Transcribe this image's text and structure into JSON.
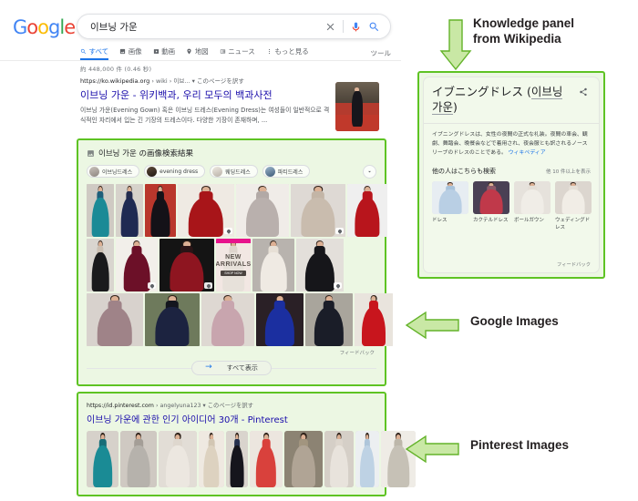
{
  "browser": {
    "logo_letters": [
      "G",
      "o",
      "o",
      "g",
      "l",
      "e"
    ],
    "search": {
      "query": "이브닝 가운",
      "placeholder": "검색",
      "clear_icon": "close-icon",
      "mic_icon": "microphone-icon",
      "search_icon": "search-icon"
    },
    "nav": {
      "tabs": [
        {
          "label": "すべて",
          "icon": "search-icon",
          "active": true
        },
        {
          "label": "画像",
          "icon": "image-icon",
          "active": false
        },
        {
          "label": "動画",
          "icon": "video-icon",
          "active": false
        },
        {
          "label": "地図",
          "icon": "map-pin-icon",
          "active": false
        },
        {
          "label": "ニュース",
          "icon": "news-icon",
          "active": false
        },
        {
          "label": "もっと見る",
          "icon": "more-vertical-icon",
          "active": false
        }
      ],
      "tools_label": "ツール"
    }
  },
  "results": {
    "stats": "約 448,000 件 (0.46 秒)",
    "organic": {
      "domain": "https://ko.wikipedia.org",
      "path": "› wiki › 이브...",
      "cache_label": "このページを訳す",
      "title": "이브닝 가운 - 위키백과, 우리 모두의 백과사전",
      "snippet": "이브닝 가운(Evening Gown) 혹은 이브닝 드레스(Evening Dress)는 여성들이 일반적으로 격식적인 자리에서 입는 긴 기장의 드레스이다. 다양한 기장이 존재하며, ..."
    }
  },
  "images_block": {
    "heading": "이브닝 가운 の画像検索結果",
    "heading_icon": "image-icon",
    "chips": [
      {
        "label": "이브닝드레스"
      },
      {
        "label": "evening dress"
      },
      {
        "label": "웨딩드레스"
      },
      {
        "label": "파티드레스"
      }
    ],
    "chips_more_icon": "chevron-down-icon",
    "feedback_label": "フィードバック",
    "show_all_label": "すべて表示",
    "show_all_icon": "arrow-right-icon",
    "grid": [
      [
        {
          "alt": "teal evening gown",
          "w": 30,
          "dress": "#1b8a96",
          "bg": "#cfcac3",
          "torso": "#1f5f7a"
        },
        {
          "alt": "navy evening gown",
          "w": 30,
          "dress": "#1f2a52",
          "bg": "#d6d2cb",
          "torso": "#232c4e"
        },
        {
          "alt": "black red carpet gown",
          "w": 34,
          "dress": "#141218",
          "bg": "#b9372c",
          "torso": "#141218"
        },
        {
          "alt": "two red gowns",
          "w": 62,
          "dress": "#a81519",
          "bg": "#efeae3",
          "torso": "#a81519",
          "badge": true
        },
        {
          "alt": "silver sequin gowns",
          "w": 58,
          "dress": "#b9b0ad",
          "bg": "#f0ece8",
          "torso": "#b2a9a6"
        },
        {
          "alt": "nude couture gown",
          "w": 60,
          "dress": "#c9bcae",
          "bg": "#ded9d4",
          "torso": "#c3b5a6",
          "badge": true
        },
        {
          "alt": "red off shoulder gown",
          "w": 44,
          "dress": "#b8151c",
          "bg": "#efefef",
          "torso": "#b8151c"
        }
      ],
      [
        {
          "alt": "black sheer gown",
          "w": 30,
          "dress": "#1a1a1c",
          "bg": "#d9d5cf",
          "torso": "#cbbfb2"
        },
        {
          "alt": "burgundy mermaid gown",
          "w": 46,
          "dress": "#6c1028",
          "bg": "#f2efea",
          "torso": "#6c1028",
          "badge": true
        },
        {
          "alt": "red beaded black gown",
          "w": 60,
          "dress": "#8e1520",
          "bg": "#141414",
          "torso": "#2a1416",
          "badge": true
        },
        {
          "alt": "white gown new arrivals",
          "w": 38,
          "dress": "#e7e1da",
          "bg": "#f2e7e3",
          "torso": "#ded5cd",
          "overlay_title": "NEW",
          "overlay_title2": "ARRIVALS",
          "overlay_cta": "SHOP NOW"
        },
        {
          "alt": "white lace gown",
          "w": 46,
          "dress": "#efeae3",
          "bg": "#b8b3ae",
          "torso": "#e7e0d6"
        },
        {
          "alt": "black strapless gown",
          "w": 52,
          "dress": "#16161a",
          "bg": "#e3dfda",
          "torso": "#16161a",
          "badge": true
        }
      ],
      [
        {
          "alt": "mauve vintage gown",
          "w": 62,
          "dress": "#9f8388",
          "bg": "#d8d2cd",
          "torso": "#9f8388"
        },
        {
          "alt": "couple formal wear",
          "w": 60,
          "dress": "#1c2340",
          "bg": "#6e7a5c",
          "torso": "#14161e"
        },
        {
          "alt": "pink tulle gown",
          "w": 58,
          "dress": "#c8a5ae",
          "bg": "#ded8d2",
          "torso": "#c8a5ae"
        },
        {
          "alt": "blue sequin gown",
          "w": 52,
          "dress": "#1b2fa0",
          "bg": "#2a2026",
          "torso": "#1b2fa0"
        },
        {
          "alt": "black feather gown",
          "w": 52,
          "dress": "#1a1d28",
          "bg": "#a9a59c",
          "torso": "#1a1d28"
        },
        {
          "alt": "red ballgown",
          "w": 42,
          "dress": "#c8151d",
          "bg": "#e9e4dd",
          "torso": "#c8151d"
        }
      ]
    ]
  },
  "pinterest_block": {
    "domain": "https://id.pinterest.com",
    "path": "› angelyuna123",
    "cache_label": "このページを訳す",
    "title": "이브닝 가운에 관한 인기 아이디어 30개 - Pinterest",
    "images": [
      {
        "alt": "teal gown",
        "w": 35,
        "dress": "#1a8b95",
        "bg": "#d6d1ca",
        "torso": "#186d78"
      },
      {
        "alt": "silver ballgown",
        "w": 40,
        "dress": "#b6b2ac",
        "bg": "#cfc9c2",
        "torso": "#a49e97"
      },
      {
        "alt": "white ballgown",
        "w": 42,
        "dress": "#ece7e0",
        "bg": "#e2ddd6",
        "torso": "#ded7ce"
      },
      {
        "alt": "champagne mermaid gown",
        "w": 28,
        "dress": "#ddd2c0",
        "bg": "#efe9e1",
        "torso": "#d2c6b3"
      },
      {
        "alt": "black navy gown",
        "w": 24,
        "dress": "#15151c",
        "bg": "#d9d4cd",
        "torso": "#25304e"
      },
      {
        "alt": "red ruffled gown",
        "w": 36,
        "dress": "#d9413c",
        "bg": "#ece6df",
        "torso": "#d9413c"
      },
      {
        "alt": "bridesmaids group",
        "w": 42,
        "dress": "#b0a495",
        "bg": "#8c8373",
        "torso": "#a2957f"
      },
      {
        "alt": "white lace gown",
        "w": 32,
        "dress": "#e8e3dc",
        "bg": "#d5cfc7",
        "torso": "#ddd6cd"
      },
      {
        "alt": "light blue gown",
        "w": 26,
        "dress": "#bed2e4",
        "bg": "#eceff1",
        "torso": "#aec5da"
      },
      {
        "alt": "silver beaded gown",
        "w": 38,
        "dress": "#c6c1b6",
        "bg": "#efece6",
        "torso": "#bdb7aa"
      }
    ]
  },
  "knowledge_panel": {
    "title_jp": "イブニングドレス (",
    "title_ko": "이브닝 가운",
    "title_close": ")",
    "share_icon": "share-icon",
    "description": "イブニングドレスは、女性の夜間の正式な礼装。夜間の車会、観劇、舞踏会、晩餐会などで着用され、夜会服とも訳されるノースリーブのドレスのことである。",
    "source_label": "ウィキペディア",
    "related_heading": "他の人はこちらも検索",
    "related_more": "他 10 件以上を表示",
    "related_items": [
      {
        "label": "ドレス",
        "dress": "#b9cfe4",
        "bg": "#e7edf2",
        "torso": "#a8c2da"
      },
      {
        "label": "カクテルドレス",
        "dress": "#c0394a",
        "bg": "#4a4054",
        "torso": "#8d5a6a"
      },
      {
        "label": "ボールガウン",
        "dress": "#f0ede7",
        "bg": "#e6e2dc",
        "torso": "#e4ded6"
      },
      {
        "label": "ウェディングドレス",
        "dress": "#f1ede6",
        "bg": "#dcd6cf",
        "torso": "#e6e0d7"
      }
    ],
    "feedback_label": "フィードバック"
  },
  "annotations": [
    {
      "id": "anno-kp",
      "text_line1": "Knowledge panel",
      "text_line2": "from Wikipedia",
      "arrow": "arrow-down-icon"
    },
    {
      "id": "anno-gi",
      "text_line1": "Google Images",
      "text_line2": "",
      "arrow": "arrow-left-icon"
    },
    {
      "id": "anno-pin",
      "text_line1": "Pinterest Images",
      "text_line2": "",
      "arrow": "arrow-left-icon"
    }
  ],
  "colors": {
    "highlight_border": "#5ec323",
    "highlight_fill": "rgba(122,200,60,0.14)",
    "link_blue": "#1a0dab",
    "google_blue": "#4285f4"
  }
}
